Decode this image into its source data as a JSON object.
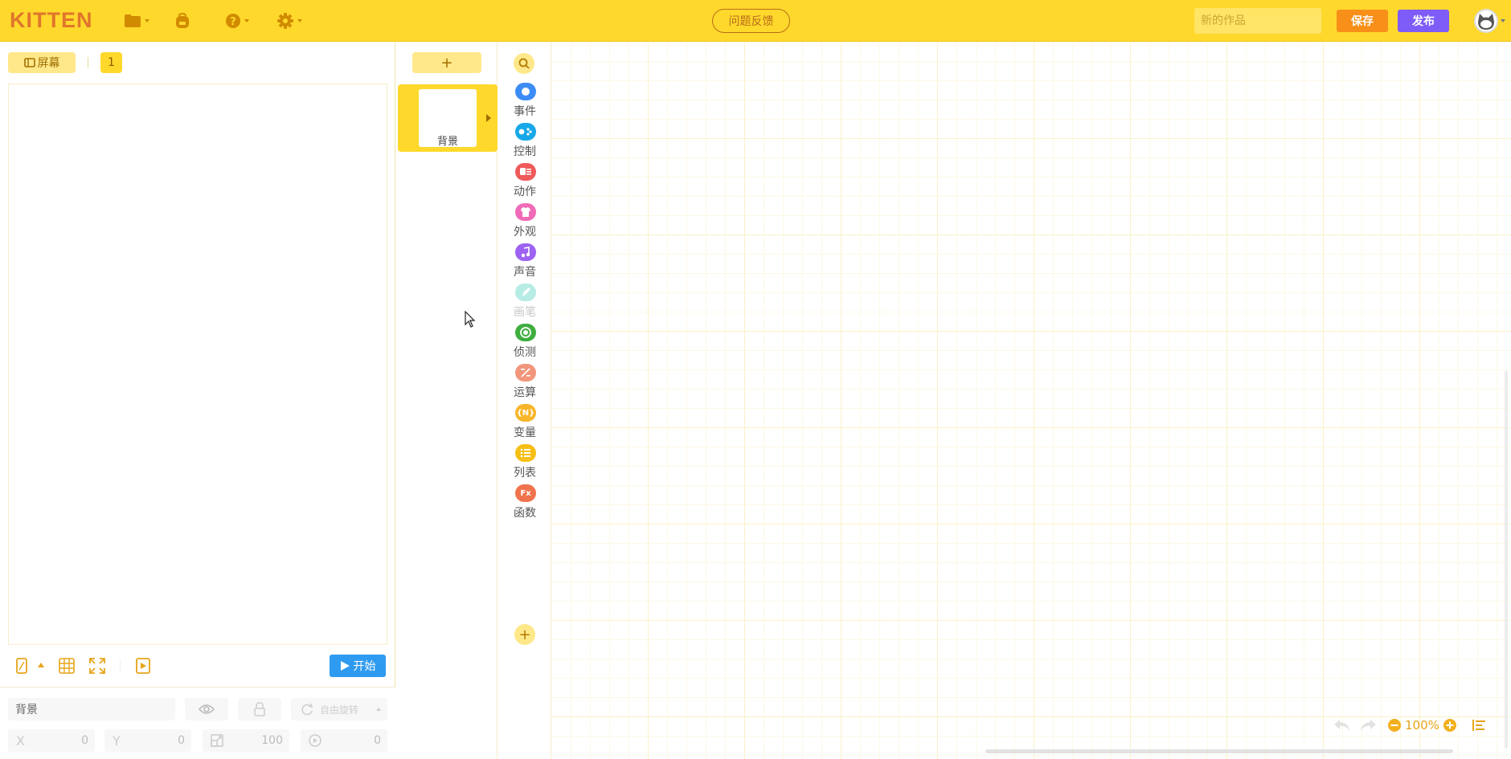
{
  "app": {
    "logo": "KITTEN",
    "feedback_label": "问题反馈",
    "title_placeholder": "新的作品",
    "save_label": "保存",
    "publish_label": "发布"
  },
  "stage": {
    "screen_tab_label": "屏幕",
    "screen_number": "1",
    "start_label": "开始",
    "sprite_name_value": "背景",
    "rotation_label": "自由旋转",
    "x_label": "X",
    "x_value": "0",
    "y_label": "Y",
    "y_value": "0",
    "size_value": "100",
    "direction_value": "0"
  },
  "sprites": {
    "add_label": "+",
    "items": [
      {
        "name": "背景"
      }
    ]
  },
  "categories": [
    {
      "id": "event",
      "label": "事件",
      "color": "#3d8cf6",
      "icon": "circle-icon"
    },
    {
      "id": "control",
      "label": "控制",
      "color": "#17a8e8",
      "icon": "gamepad-icon"
    },
    {
      "id": "action",
      "label": "动作",
      "color": "#ef5a5a",
      "icon": "robot-icon"
    },
    {
      "id": "looks",
      "label": "外观",
      "color": "#f06bb7",
      "icon": "shirt-icon"
    },
    {
      "id": "sound",
      "label": "声音",
      "color": "#9d62f1",
      "icon": "music-icon"
    },
    {
      "id": "pen",
      "label": "画笔",
      "color": "#b6ece4",
      "icon": "pen-icon",
      "disabled": true
    },
    {
      "id": "sensing",
      "label": "侦测",
      "color": "#3fae3f",
      "icon": "target-icon"
    },
    {
      "id": "operator",
      "label": "运算",
      "color": "#f1967b",
      "icon": "operator-icon"
    },
    {
      "id": "variable",
      "label": "变量",
      "color": "#f7b62a",
      "icon": "variable-icon",
      "glyph": "{N}"
    },
    {
      "id": "list",
      "label": "列表",
      "color": "#f6bf16",
      "icon": "list-icon"
    },
    {
      "id": "function",
      "label": "函数",
      "color": "#f0734d",
      "icon": "function-icon",
      "glyph": "Fx"
    }
  ],
  "workspace": {
    "zoom": "100%"
  }
}
